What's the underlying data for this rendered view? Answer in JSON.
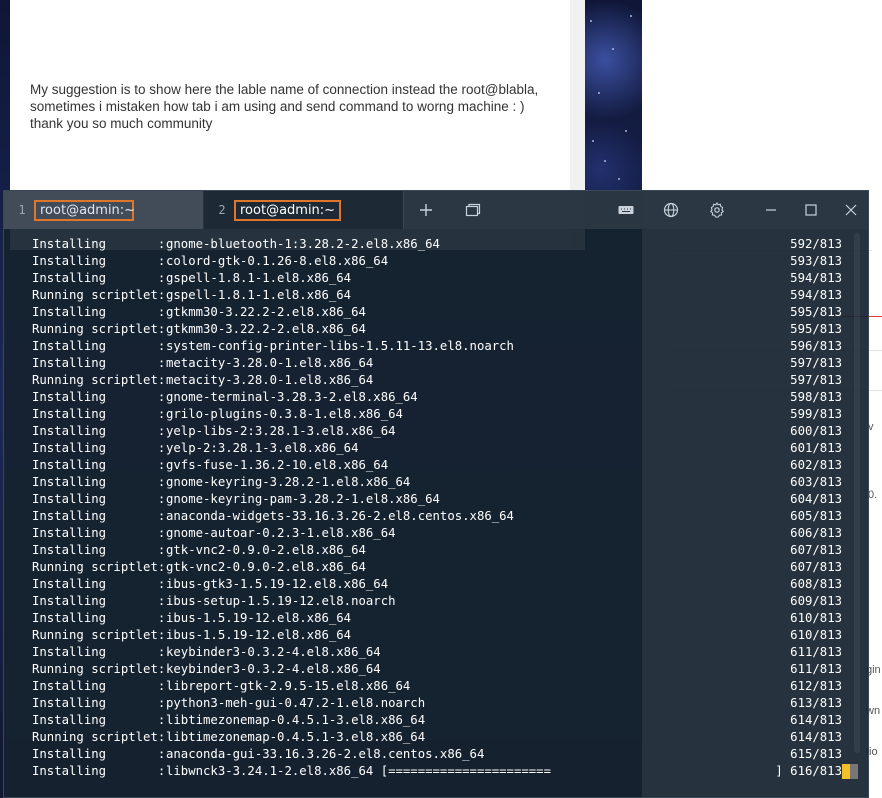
{
  "forum": {
    "line1": "My suggestion is to show here the lable name of connection instead the root@blabla,",
    "line2": "sometimes i mistaken how tab i am using and send command to worng machine : )",
    "line3": "thank you so much community"
  },
  "right_panel": {
    "frag1": "v",
    "frag2": "0.",
    "frag3": "gin",
    "frag4": "wn",
    "frag5": "tio"
  },
  "terminal": {
    "tabs": [
      {
        "number": "1",
        "label": "root@admin:~"
      },
      {
        "number": "2",
        "label": "root@admin:~"
      }
    ],
    "icons": {
      "new_tab": "plus-icon",
      "duplicate": "duplicate-tab-icon",
      "keyboard": "keyboard-icon",
      "globe": "globe-icon",
      "settings": "gear-icon",
      "minimize": "minimize-icon",
      "maximize": "maximize-icon",
      "close": "close-icon"
    },
    "cursor_color": "#f4c02a",
    "tab_highlight_color": "#e0762a",
    "lines": [
      {
        "action": "Installing       :",
        "package": "gnome-bluetooth-1:3.28.2-2.el8.x86_64",
        "count": "592/813"
      },
      {
        "action": "Installing       :",
        "package": "colord-gtk-0.1.26-8.el8.x86_64",
        "count": "593/813"
      },
      {
        "action": "Installing       :",
        "package": "gspell-1.8.1-1.el8.x86_64",
        "count": "594/813"
      },
      {
        "action": "Running scriptlet:",
        "package": "gspell-1.8.1-1.el8.x86_64",
        "count": "594/813"
      },
      {
        "action": "Installing       :",
        "package": "gtkmm30-3.22.2-2.el8.x86_64",
        "count": "595/813"
      },
      {
        "action": "Running scriptlet:",
        "package": "gtkmm30-3.22.2-2.el8.x86_64",
        "count": "595/813"
      },
      {
        "action": "Installing       :",
        "package": "system-config-printer-libs-1.5.11-13.el8.noarch",
        "count": "596/813"
      },
      {
        "action": "Installing       :",
        "package": "metacity-3.28.0-1.el8.x86_64",
        "count": "597/813"
      },
      {
        "action": "Running scriptlet:",
        "package": "metacity-3.28.0-1.el8.x86_64",
        "count": "597/813"
      },
      {
        "action": "Installing       :",
        "package": "gnome-terminal-3.28.3-2.el8.x86_64",
        "count": "598/813"
      },
      {
        "action": "Installing       :",
        "package": "grilo-plugins-0.3.8-1.el8.x86_64",
        "count": "599/813"
      },
      {
        "action": "Installing       :",
        "package": "yelp-libs-2:3.28.1-3.el8.x86_64",
        "count": "600/813"
      },
      {
        "action": "Installing       :",
        "package": "yelp-2:3.28.1-3.el8.x86_64",
        "count": "601/813"
      },
      {
        "action": "Installing       :",
        "package": "gvfs-fuse-1.36.2-10.el8.x86_64",
        "count": "602/813"
      },
      {
        "action": "Installing       :",
        "package": "gnome-keyring-3.28.2-1.el8.x86_64",
        "count": "603/813"
      },
      {
        "action": "Installing       :",
        "package": "gnome-keyring-pam-3.28.2-1.el8.x86_64",
        "count": "604/813"
      },
      {
        "action": "Installing       :",
        "package": "anaconda-widgets-33.16.3.26-2.el8.centos.x86_64",
        "count": "605/813"
      },
      {
        "action": "Installing       :",
        "package": "gnome-autoar-0.2.3-1.el8.x86_64",
        "count": "606/813"
      },
      {
        "action": "Installing       :",
        "package": "gtk-vnc2-0.9.0-2.el8.x86_64",
        "count": "607/813"
      },
      {
        "action": "Running scriptlet:",
        "package": "gtk-vnc2-0.9.0-2.el8.x86_64",
        "count": "607/813"
      },
      {
        "action": "Installing       :",
        "package": "ibus-gtk3-1.5.19-12.el8.x86_64",
        "count": "608/813"
      },
      {
        "action": "Installing       :",
        "package": "ibus-setup-1.5.19-12.el8.noarch",
        "count": "609/813"
      },
      {
        "action": "Installing       :",
        "package": "ibus-1.5.19-12.el8.x86_64",
        "count": "610/813"
      },
      {
        "action": "Running scriptlet:",
        "package": "ibus-1.5.19-12.el8.x86_64",
        "count": "610/813"
      },
      {
        "action": "Installing       :",
        "package": "keybinder3-0.3.2-4.el8.x86_64",
        "count": "611/813"
      },
      {
        "action": "Running scriptlet:",
        "package": "keybinder3-0.3.2-4.el8.x86_64",
        "count": "611/813"
      },
      {
        "action": "Installing       :",
        "package": "libreport-gtk-2.9.5-15.el8.x86_64",
        "count": "612/813"
      },
      {
        "action": "Installing       :",
        "package": "python3-meh-gui-0.47.2-1.el8.noarch",
        "count": "613/813"
      },
      {
        "action": "Installing       :",
        "package": "libtimezonemap-0.4.5.1-3.el8.x86_64",
        "count": "614/813"
      },
      {
        "action": "Running scriptlet:",
        "package": "libtimezonemap-0.4.5.1-3.el8.x86_64",
        "count": "614/813"
      },
      {
        "action": "Installing       :",
        "package": "anaconda-gui-33.16.3.26-2.el8.centos.x86_64",
        "count": "615/813"
      },
      {
        "action": "Installing       :",
        "package": "libwnck3-3.24.1-2.el8.x86_64 [======================",
        "count": "] 616/813"
      }
    ]
  }
}
